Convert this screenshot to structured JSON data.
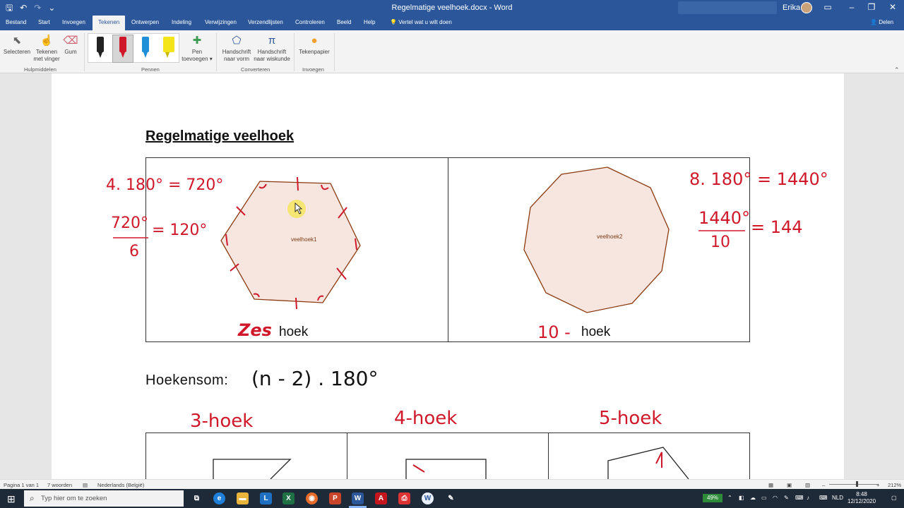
{
  "window": {
    "title": "Regelmatige veelhoek.docx - Word",
    "user": "Erika",
    "qat": [
      "save-icon",
      "undo-icon",
      "redo-icon",
      "customize-icon"
    ]
  },
  "tabs": [
    "Bestand",
    "Start",
    "Invoegen",
    "Tekenen",
    "Ontwerpen",
    "Indeling",
    "Verwijzingen",
    "Verzendlijsten",
    "Controleren",
    "Beeld",
    "Help"
  ],
  "active_tab": "Tekenen",
  "tell_me": "Vertel wat u wilt doen",
  "share": "Delen",
  "ribbon": {
    "select": "Selecteren",
    "finger_line1": "Tekenen",
    "finger_line2": "met vinger",
    "eraser": "Gum",
    "group_tools": "Hulpmiddelen",
    "add_pen_line1": "Pen",
    "add_pen_line2": "toevoegen",
    "group_pens": "Pennen",
    "shape_line1": "Handschrift",
    "shape_line2": "naar vorm",
    "math_line1": "Handschrift",
    "math_line2": "naar wiskunde",
    "group_convert": "Converteren",
    "canvas": "Tekenpapier",
    "group_insert": "Invoegen"
  },
  "document": {
    "heading": "Regelmatige veelhoek",
    "cell1_label": "hoek",
    "cell1_shape": "veelhoek1",
    "cell2_label": "hoek",
    "cell2_shape": "veelhoek2",
    "formula_label": "Hoekensom:",
    "ink": {
      "left_line1": "4. 180° = 720°",
      "left_num": "720°",
      "left_den": "6",
      "left_result": "= 120°",
      "right_line1": "8. 180° = 1440°",
      "right_num": "1440°",
      "right_den": "10",
      "right_result": "= 144",
      "cell1_prefix": "Zes",
      "cell2_prefix": "10 -",
      "formula": "(n - 2) . 180°",
      "row2_a": "3-hoek",
      "row2_b": "4-hoek",
      "row2_c": "5-hoek"
    }
  },
  "status": {
    "page": "Pagina 1 van 1",
    "words": "7 woorden",
    "language": "Nederlands (België)",
    "zoom": "212%"
  },
  "taskbar": {
    "search_placeholder": "Typ hier om te zoeken",
    "battery": "49%",
    "lang": "NLD",
    "time": "8:48",
    "date": "12/12/2020"
  }
}
